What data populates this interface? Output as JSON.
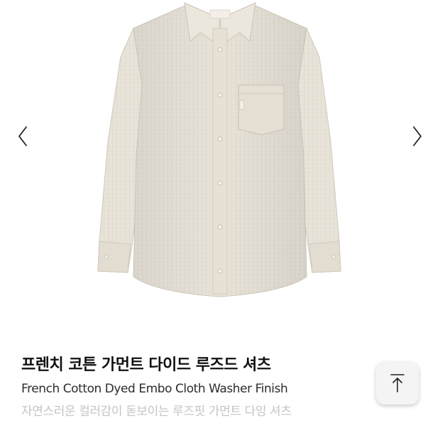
{
  "carousel": {
    "image_label": "French Cotton Dyed Embo Cloth Washer Finish shirt",
    "prev_icon": "chevron-left-icon",
    "next_icon": "chevron-right-icon"
  },
  "product": {
    "title_ko": "프렌치 코튼 가먼트 다이드 루즈드 셔츠",
    "title_en": "French Cotton Dyed Embo Cloth Washer Finish",
    "description": "자연스러운 컬러감이 돋보이는 루즈핏 가먼트 다잉 셔츠"
  },
  "scroll_top": {
    "icon": "arrow-up-to-top-icon"
  },
  "colors": {
    "shirt": "#e9e4da",
    "shirt_shadow": "#d6d0c4",
    "stripe": "#cfc8bb",
    "text_primary": "#111111",
    "text_secondary": "#2c2c2c",
    "text_muted": "#c4c4c4"
  }
}
